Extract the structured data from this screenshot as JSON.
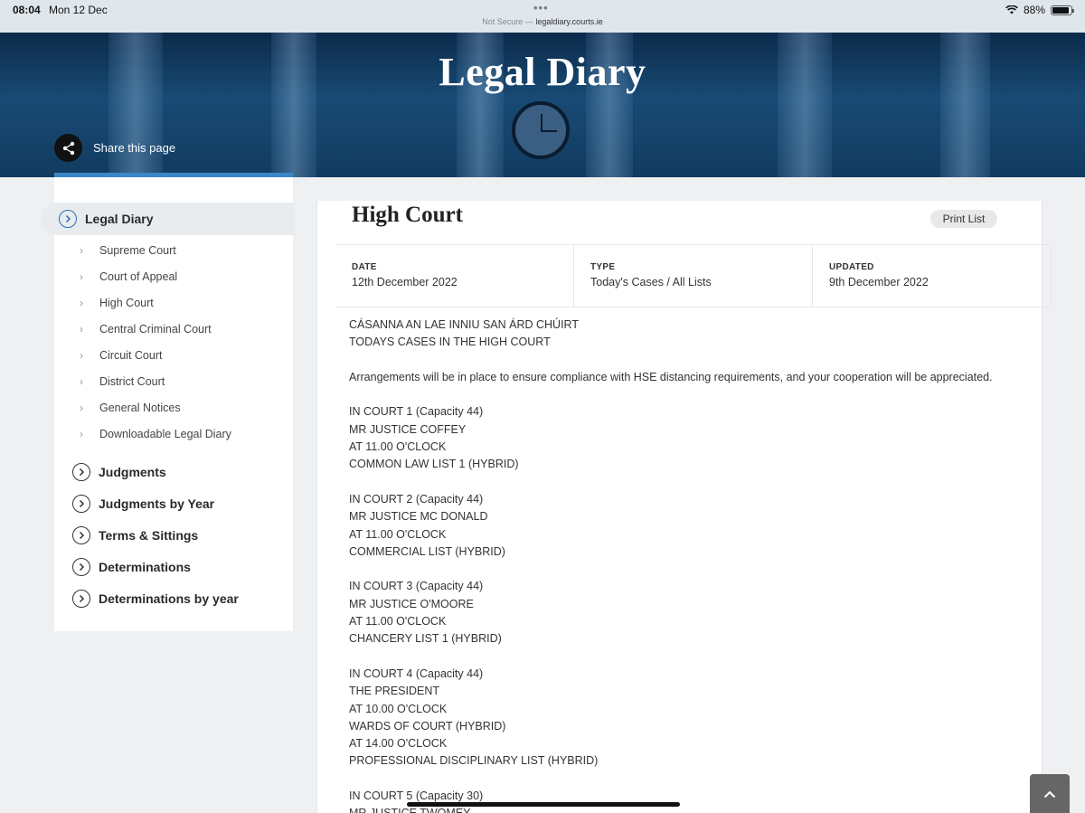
{
  "statusbar": {
    "time": "08:04",
    "date": "Mon 12 Dec",
    "url_prefix": "Not Secure —",
    "url": "legaldiary.courts.ie",
    "battery": "88%"
  },
  "hero": {
    "title": "Legal Diary",
    "share_label": "Share this page"
  },
  "sidebar": {
    "active": "Legal Diary",
    "sub_items": [
      "Supreme Court",
      "Court of Appeal",
      "High Court",
      "Central Criminal Court",
      "Circuit Court",
      "District Court",
      "General Notices",
      "Downloadable Legal Diary"
    ],
    "main_items": [
      "Judgments",
      "Judgments by Year",
      "Terms & Sittings",
      "Determinations",
      "Determinations by year"
    ]
  },
  "main": {
    "title": "High Court",
    "print_label": "Print List",
    "info": {
      "date_label": "DATE",
      "date_value": "12th December 2022",
      "type_label": "TYPE",
      "type_value": "Today's Cases / All Lists",
      "updated_label": "UPDATED",
      "updated_value": "9th December 2022"
    },
    "lines": [
      "CÁSANNA AN LAE INNIU SAN ÁRD CHÚIRT",
      "TODAYS CASES IN THE HIGH COURT",
      "",
      "Arrangements will be in place to ensure compliance with HSE distancing requirements, and your cooperation will be appreciated.",
      "",
      "IN COURT 1 (Capacity 44)",
      "MR JUSTICE COFFEY",
      "AT 11.00 O'CLOCK",
      "COMMON LAW LIST 1 (HYBRID)",
      "",
      "IN COURT 2 (Capacity 44)",
      "MR JUSTICE MC DONALD",
      "AT 11.00 O'CLOCK",
      "COMMERCIAL LIST (HYBRID)",
      "",
      "IN COURT 3 (Capacity 44)",
      "MR JUSTICE O'MOORE",
      "AT 11.00 O'CLOCK",
      "CHANCERY LIST 1 (HYBRID)",
      "",
      "IN COURT 4 (Capacity 44)",
      "THE PRESIDENT",
      "AT 10.00 O'CLOCK",
      "WARDS OF COURT (HYBRID)",
      "AT 14.00 O'CLOCK",
      "PROFESSIONAL DISCIPLINARY LIST (HYBRID)",
      "",
      "IN COURT 5 (Capacity 30)",
      "MR JUSTICE TWOMEY"
    ]
  }
}
